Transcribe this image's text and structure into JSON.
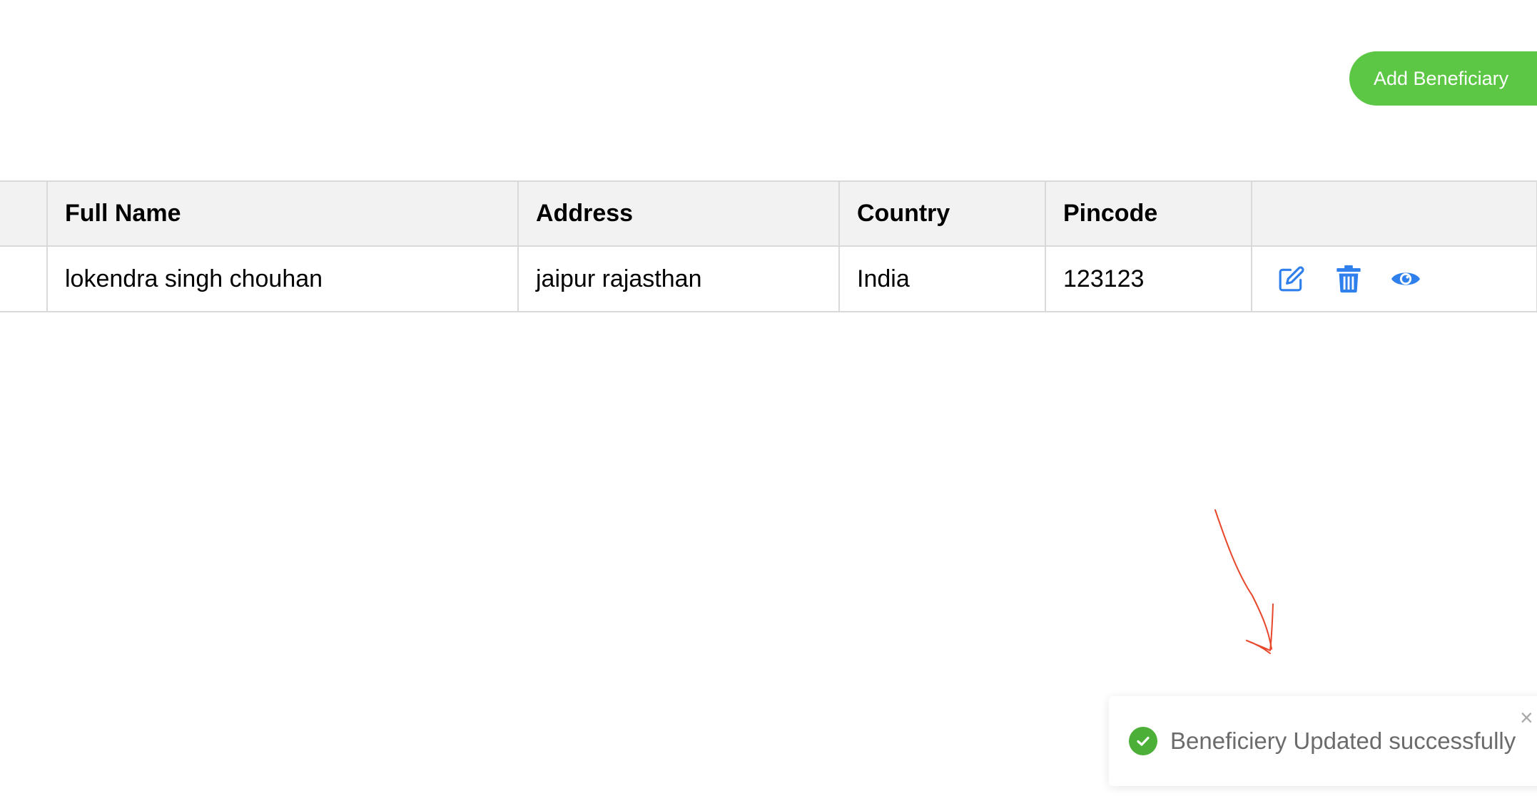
{
  "toolbar": {
    "add_button_label": "Add Beneficiary"
  },
  "table": {
    "columns": [
      "",
      "Full Name",
      "Address",
      "Country",
      "Pincode",
      ""
    ],
    "rows": [
      {
        "full_name": "lokendra singh chouhan",
        "address": "jaipur rajasthan",
        "country": "India",
        "pincode": "123123",
        "actions": [
          "edit-icon",
          "trash-icon",
          "eye-icon"
        ]
      }
    ]
  },
  "toast": {
    "message": "Beneficiery Updated successfully",
    "close_glyph": "×",
    "status": "success"
  },
  "colors": {
    "primary_button": "#5cc744",
    "action_icon": "#2f80ed",
    "success_check": "#4caf37",
    "annotation_arrow": "#e8472b"
  }
}
